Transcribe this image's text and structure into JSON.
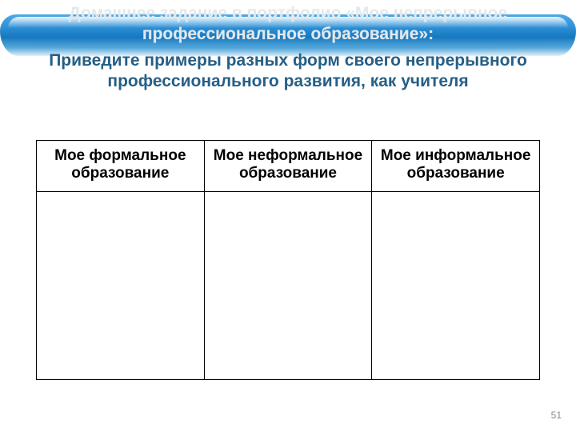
{
  "header": {
    "muted_title": "Домашнее задание в портфолио «Мое непрерывное профессиональное образование»:",
    "subtitle": "Приведите примеры разных форм своего непрерывного профессионального развития, как учителя"
  },
  "table": {
    "headers": [
      "Мое формальное образование",
      "Мое неформальное образование",
      "Мое информальное образование"
    ],
    "rows": [
      [
        "",
        "",
        ""
      ]
    ]
  },
  "page_number": "51"
}
